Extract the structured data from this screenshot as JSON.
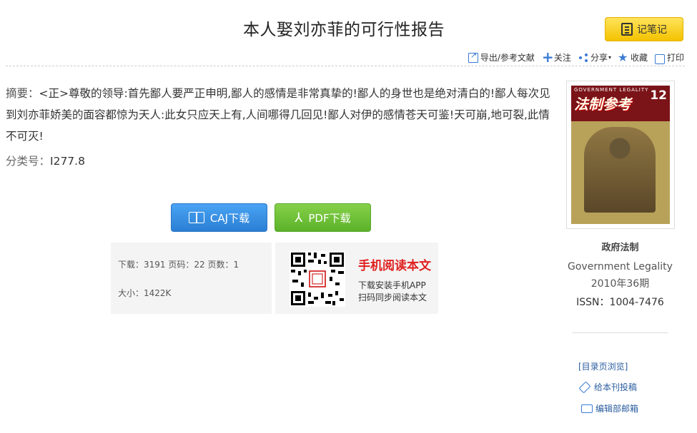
{
  "title": "本人娶刘亦菲的可行性报告",
  "note_button": "记笔记",
  "toolbar": {
    "export": "导出/参考文献",
    "follow": "关注",
    "share": "分享",
    "share_caret": "▾",
    "favorite": "收藏",
    "print": "打印"
  },
  "abstract": {
    "label": "摘要：",
    "text": "<正>尊敬的领导:首先鄙人要严正申明,鄙人的感情是非常真挚的!鄙人的身世也是绝对清白的!鄙人每次见到刘亦菲娇美的面容都惊为天人:此女只应天上有,人间哪得几回见!鄙人对伊的感情苍天可鉴!天可崩,地可裂,此情不可灭!"
  },
  "classification": {
    "label": "分类号：",
    "value": "I277.8"
  },
  "download": {
    "caj": "CAJ下载",
    "pdf": "PDF下载"
  },
  "stats": {
    "line1": "下载：3191   页码：22   页数：1",
    "line2": "大小：1422K"
  },
  "mobile": {
    "title": "手机阅读本文",
    "line1": "下载安装手机APP",
    "line2": "扫码同步阅读本文"
  },
  "cover": {
    "en": "GOVERNMENT LEGALITY",
    "cn": "法制参考",
    "num": "12"
  },
  "journal": {
    "name": "政府法制",
    "en_name": "Government Legality",
    "issue": "2010年36期",
    "issn": "ISSN：1004-7476"
  },
  "side_links": {
    "toc": "[目录页浏览]",
    "submit": "给本刊投稿",
    "email": "编辑部邮箱"
  }
}
